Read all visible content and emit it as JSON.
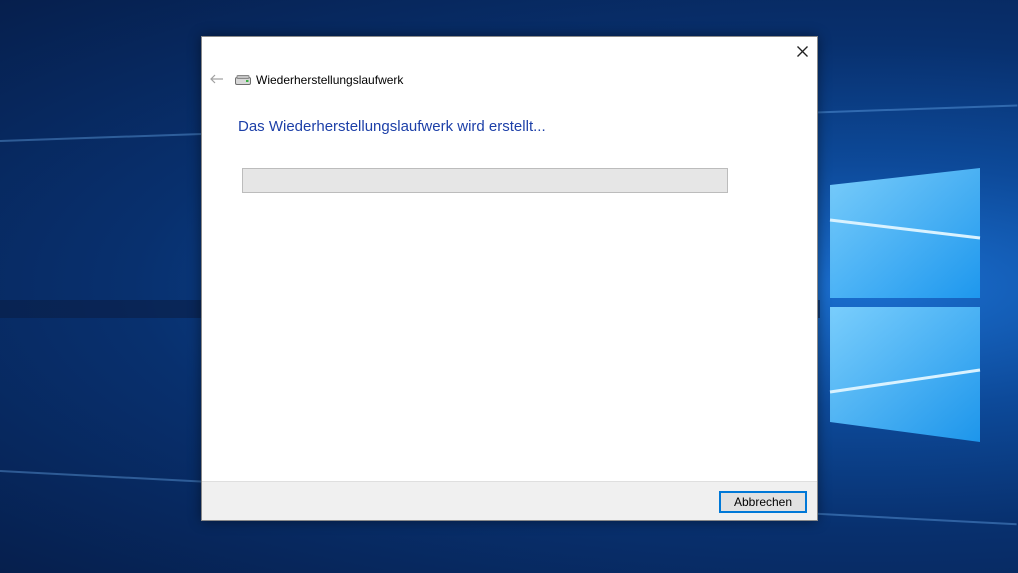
{
  "dialog": {
    "title": "Wiederherstellungslaufwerk",
    "heading": "Das Wiederherstellungslaufwerk wird erstellt...",
    "progress_fraction": 0.0,
    "cancel_label": "Abbrechen",
    "icons": {
      "close": "close-icon",
      "back": "back-arrow-icon",
      "drive": "drive-icon"
    }
  },
  "colors": {
    "heading": "#1c3fa8",
    "button_focus_border": "#0078d7",
    "progress_track": "#e6e6e6"
  }
}
